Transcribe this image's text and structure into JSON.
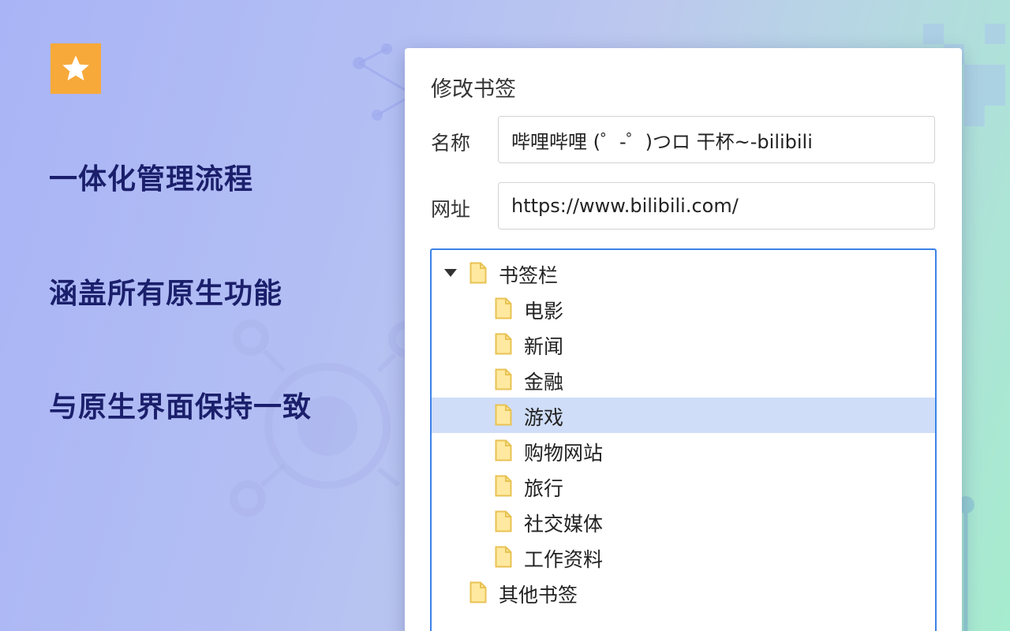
{
  "features": [
    "一体化管理流程",
    "涵盖所有原生功能",
    "与原生界面保持一致"
  ],
  "dialog": {
    "title": "修改书签",
    "name_label": "名称",
    "name_value": "哔哩哔哩 (゜-゜)つロ 干杯~-bilibili",
    "url_label": "网址",
    "url_value": "https://www.bilibili.com/"
  },
  "tree": {
    "root": {
      "label": "书签栏",
      "expanded": true,
      "children": [
        "电影",
        "新闻",
        "金融",
        "游戏",
        "购物网站",
        "旅行",
        "社交媒体",
        "工作资料"
      ]
    },
    "other": "其他书签",
    "selected": "游戏"
  },
  "colors": {
    "logo": "#f7a93a",
    "feature_text": "#1b1f6b",
    "tree_border": "#3b82e8",
    "selected_row": "#cfddf8",
    "folder_fill": "#ffe9a0",
    "folder_stroke": "#e8c253"
  },
  "icons": {
    "logo": "star-icon",
    "folder": "folder-icon",
    "expand": "caret-down-icon"
  }
}
